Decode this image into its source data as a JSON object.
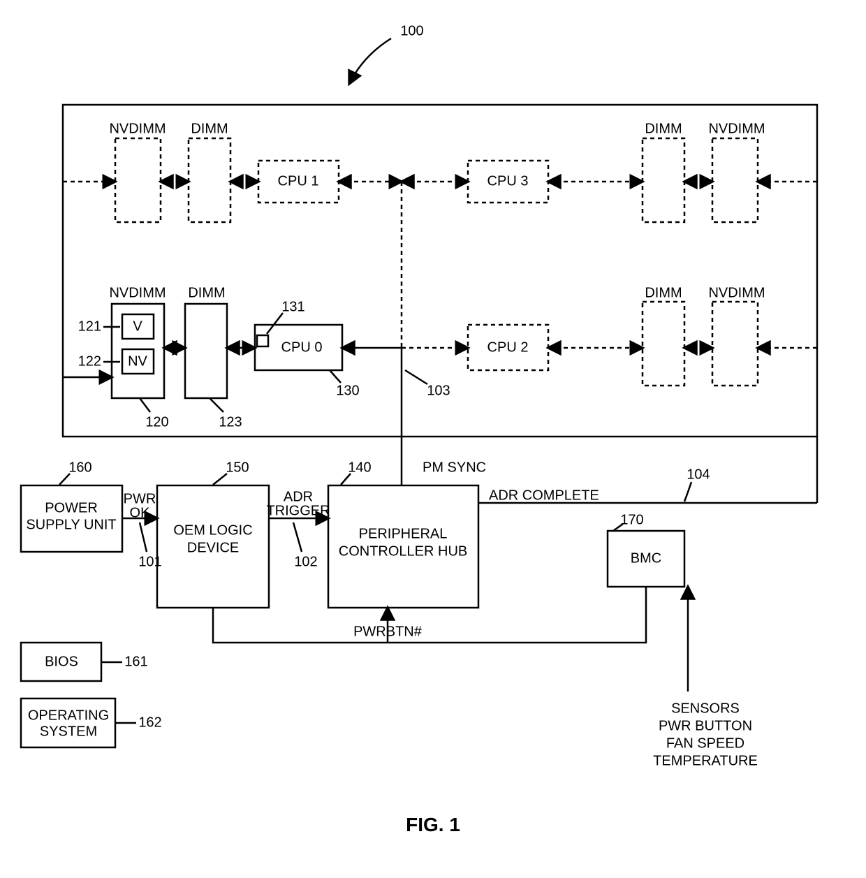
{
  "figure_ref": "100",
  "figure_caption": "FIG. 1",
  "outer_block_ref": "",
  "top": {
    "nvdimm_tl": "NVDIMM",
    "dimm_tl": "DIMM",
    "cpu1": "CPU 1",
    "cpu3": "CPU 3",
    "dimm_tr": "DIMM",
    "nvdimm_tr": "NVDIMM"
  },
  "bottom_row": {
    "nvdimm_label": "NVDIMM",
    "dimm_label": "DIMM",
    "v": "V",
    "nv": "NV",
    "cpu0": "CPU 0",
    "cpu2": "CPU 2",
    "dimm_r": "DIMM",
    "nvdimm_r": "NVDIMM"
  },
  "refs": {
    "v": "121",
    "nv": "122",
    "nvdimm": "120",
    "dimm": "123",
    "cpu0": "130",
    "cpu0_cache": "131",
    "pm_sync_wire": "103",
    "adr_complete_wire": "104",
    "psu": "160",
    "oem": "150",
    "pch": "140",
    "bmc": "170",
    "pwrok": "101",
    "adr_trigger": "102",
    "bios": "161",
    "os": "162"
  },
  "blocks": {
    "psu": "POWER SUPPLY UNIT",
    "oem": "OEM LOGIC DEVICE",
    "pch": "PERIPHERAL CONTROLLER HUB",
    "bmc": "BMC",
    "bios": "BIOS",
    "os": "OPERATING SYSTEM"
  },
  "signals": {
    "pwrok": "PWR OK",
    "adr_trigger": "ADR TRIGGER",
    "pm_sync": "PM SYNC",
    "adr_complete": "ADR COMPLETE",
    "pwrbtn": "PWRBTN#"
  },
  "sensors": [
    "SENSORS",
    "PWR BUTTON",
    "FAN SPEED",
    "TEMPERATURE"
  ]
}
